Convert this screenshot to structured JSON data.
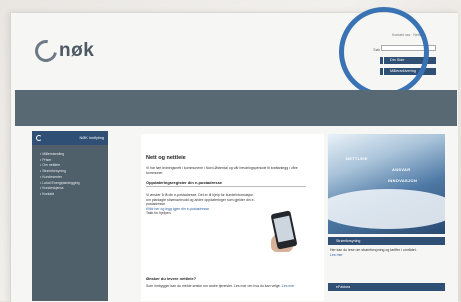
{
  "brand": {
    "name": "nøk"
  },
  "top_links": "Kontakt oss · Nettkart",
  "search": {
    "label": "Søk",
    "placeholder": ""
  },
  "nav_buttons": [
    "Din Side",
    "Målerarkivering"
  ],
  "sidebar": {
    "title": "NØK Innflyting",
    "items": [
      "Målerstanding",
      "Priser",
      "Om nettleie",
      "Strømforsyning",
      "Kundesenter",
      "Lokal Energiplanlegging",
      "Kundeskjema",
      "Kontakt"
    ]
  },
  "main": {
    "title": "Nett og nettleie",
    "intro": "Vi har ført ledningsnett i kommunene i Nord-Østerdal og vår bevaringsperiode til kraftanlegg i våre kommuner.",
    "section1": {
      "heading": "Oppdateringsregister din e-postadresse",
      "body": "Vi ønsker å få din e-postadresse. Det er til hjelp for kundeinformasjon om planlagte strømavbrudd og andre oppdateringer som gjelder din e-postadresse.",
      "link": "Klikk her og legg igjen din e-postadresse.",
      "thanks": "Takk for hjelpen."
    },
    "section2": {
      "heading": "Ønsker du levere nettleie?",
      "body": "Som innbygger kan du melde ønske om andre tjenester. Les mer om hva du kan velge.",
      "link": "Les mer"
    }
  },
  "right": {
    "captions": [
      "NETTLEIE",
      "ANSVAR",
      "INNOVASJON"
    ],
    "panel1": {
      "title": "Strømforsyning",
      "body": "Her kan du lese om strømforsyning og tariffer i området.",
      "link": "Les mer"
    },
    "panel2": {
      "title": "eFaktura"
    }
  },
  "colors": {
    "accent": "#2f4f74",
    "header_band": "#596973",
    "highlight_ring": "#3a73b3"
  }
}
